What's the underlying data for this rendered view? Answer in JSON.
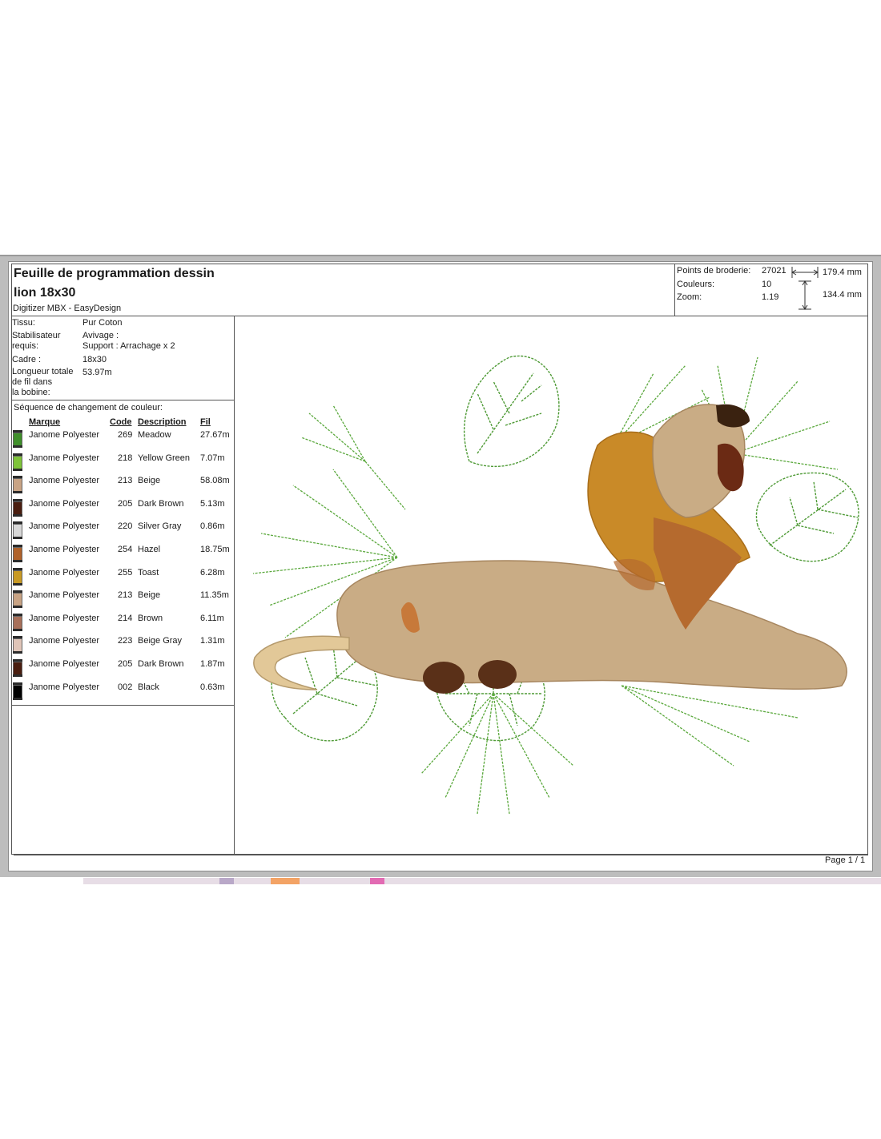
{
  "header": {
    "title_line1": "Feuille de programmation dessin",
    "title_line2": "lion 18x30",
    "software": "Digitizer MBX - EasyDesign"
  },
  "stats": {
    "points_label": "Points de broderie:",
    "points_value": "27021",
    "colors_label": "Couleurs:",
    "colors_value": "10",
    "zoom_label": "Zoom:",
    "zoom_value": "1.19",
    "width": "179.4 mm",
    "height": "134.4 mm"
  },
  "info": {
    "tissu_label": "Tissu:",
    "tissu_value": "Pur Coton",
    "stab_label_1": "Stabilisateur",
    "stab_label_2": "requis:",
    "stab_value_1": "Avivage :",
    "stab_value_2": "Support : Arrachage x 2",
    "cadre_label": "Cadre :",
    "cadre_value": "18x30",
    "longueur_label_1": "Longueur totale",
    "longueur_label_2": "de fil dans",
    "longueur_label_3": "la bobine:",
    "longueur_value": "53.97m"
  },
  "sequence": {
    "title": "Séquence de changement de couleur:",
    "headers": {
      "brand": "Marque",
      "code": "Code",
      "description": "Description",
      "thread": "Fil"
    },
    "rows": [
      {
        "brand": "Janome Polyester",
        "code": "269",
        "description": "Meadow",
        "thread": "27.67m",
        "color": "#3f8f2a"
      },
      {
        "brand": "Janome Polyester",
        "code": "218",
        "description": "Yellow Green",
        "thread": "7.07m",
        "color": "#7fc43a"
      },
      {
        "brand": "Janome Polyester",
        "code": "213",
        "description": "Beige",
        "thread": "58.08m",
        "color": "#c8a384"
      },
      {
        "brand": "Janome Polyester",
        "code": "205",
        "description": "Dark Brown",
        "thread": "5.13m",
        "color": "#4a1e10"
      },
      {
        "brand": "Janome Polyester",
        "code": "220",
        "description": "Silver Gray",
        "thread": "0.86m",
        "color": "#d8d8d8"
      },
      {
        "brand": "Janome Polyester",
        "code": "254",
        "description": "Hazel",
        "thread": "18.75m",
        "color": "#b0622a"
      },
      {
        "brand": "Janome Polyester",
        "code": "255",
        "description": "Toast",
        "thread": "6.28m",
        "color": "#c99a24"
      },
      {
        "brand": "Janome Polyester",
        "code": "213",
        "description": "Beige",
        "thread": "11.35m",
        "color": "#c8a384"
      },
      {
        "brand": "Janome Polyester",
        "code": "214",
        "description": "Brown",
        "thread": "6.11m",
        "color": "#a8705a"
      },
      {
        "brand": "Janome Polyester",
        "code": "223",
        "description": "Beige Gray",
        "thread": "1.31m",
        "color": "#e0c5b8"
      },
      {
        "brand": "Janome Polyester",
        "code": "205",
        "description": "Dark Brown",
        "thread": "1.87m",
        "color": "#4a1e10"
      },
      {
        "brand": "Janome Polyester",
        "code": "002",
        "description": "Black",
        "thread": "0.63m",
        "color": "#000000"
      }
    ]
  },
  "footer": {
    "page": "Page 1 / 1"
  }
}
